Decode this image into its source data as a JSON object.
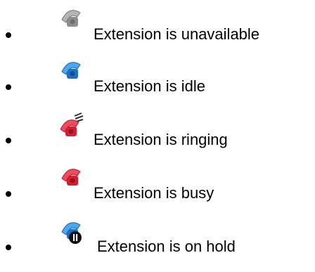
{
  "legend": {
    "items": [
      {
        "icon": "phone-unavailable-icon",
        "color": "#9a9a9a",
        "label": "Extension is unavailable"
      },
      {
        "icon": "phone-idle-icon",
        "color": "#2f8fe3",
        "label": "Extension is idle"
      },
      {
        "icon": "phone-ringing-icon",
        "color": "#f2354a",
        "label": "Extension is ringing"
      },
      {
        "icon": "phone-busy-icon",
        "color": "#f2354a",
        "label": "Extension is busy"
      },
      {
        "icon": "phone-on-hold-icon",
        "color": "#3f8fe0",
        "label": "Extension is on hold"
      }
    ]
  }
}
